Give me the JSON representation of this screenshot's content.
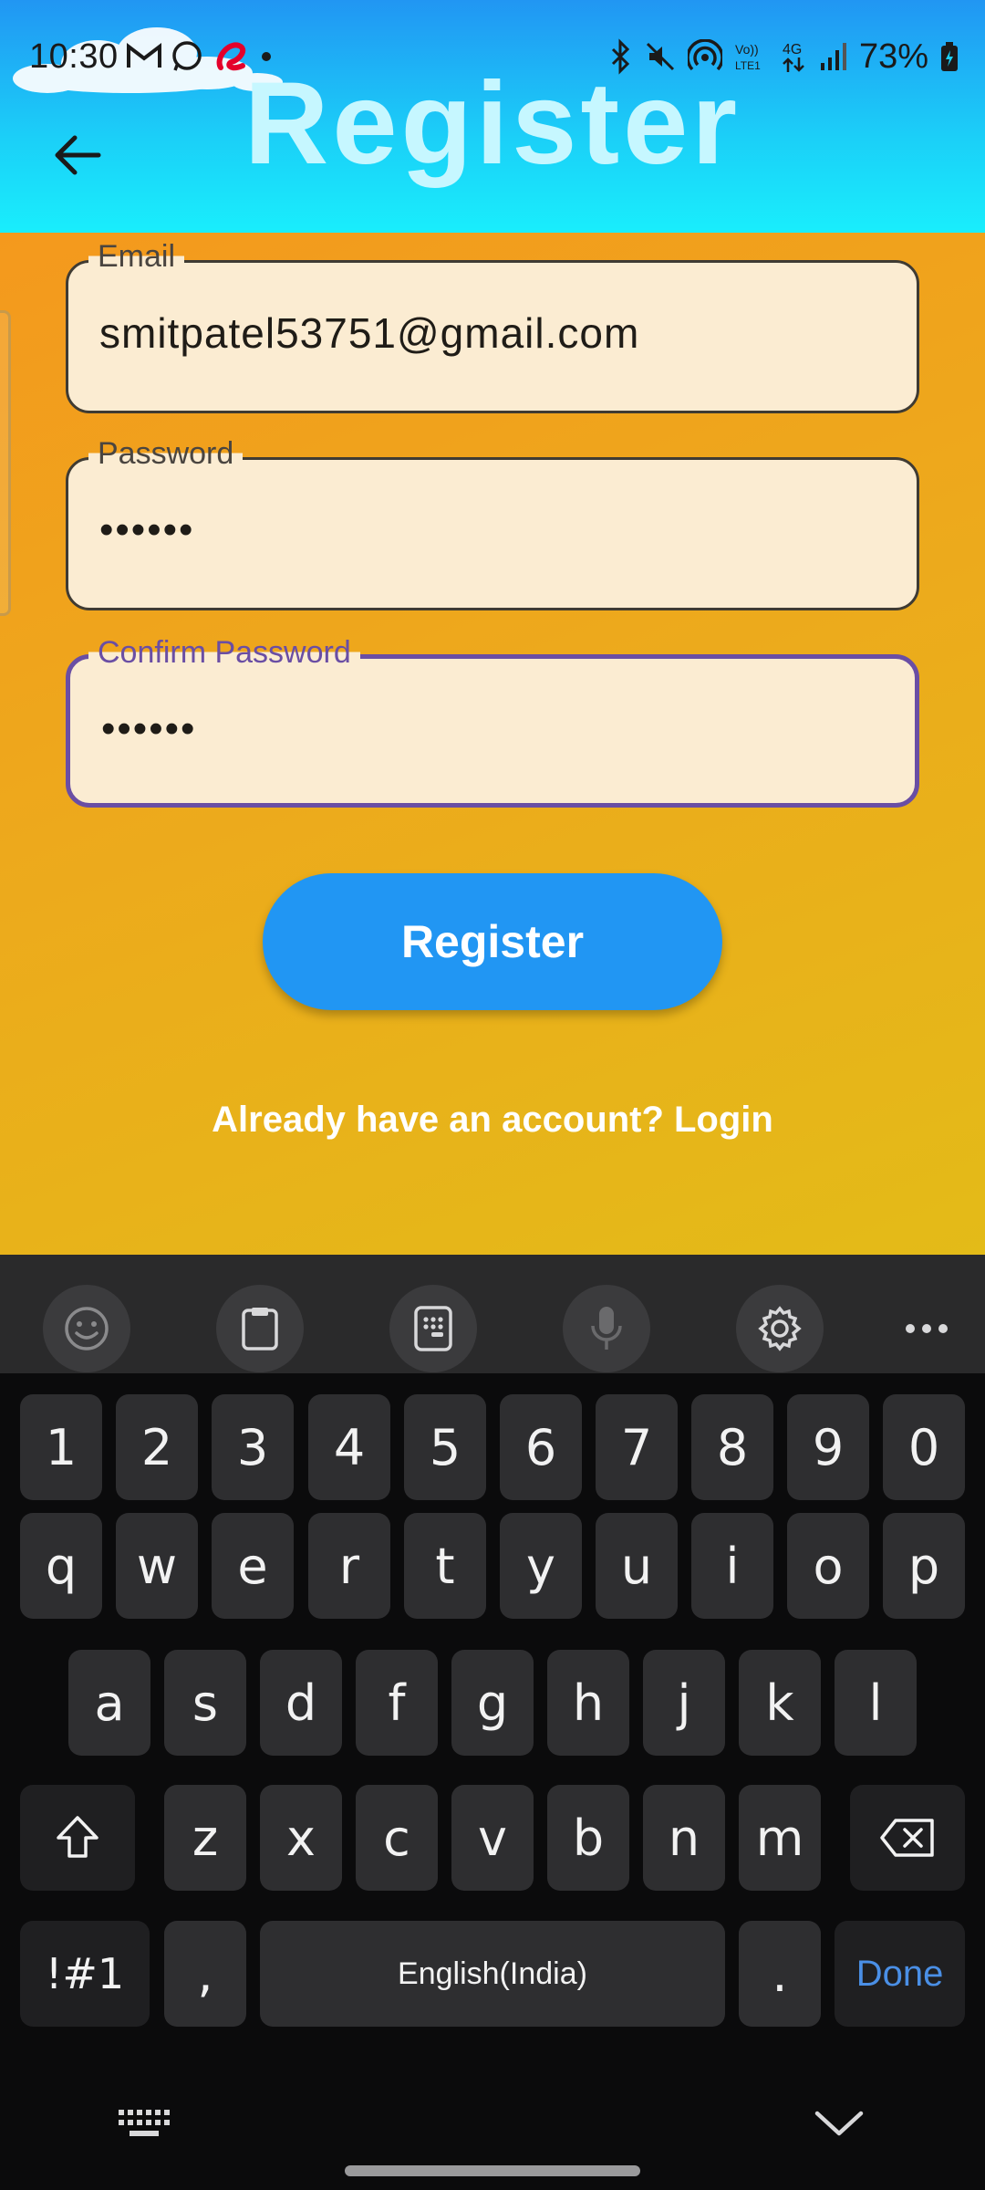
{
  "status_bar": {
    "time": "10:30",
    "battery": "73%",
    "network": "4G"
  },
  "header": {
    "title": "Register",
    "back_icon": "arrow-left-icon",
    "background_top": "#2196f3",
    "background_bottom": "#19eefc"
  },
  "form": {
    "email": {
      "label": "Email",
      "value": "smitpatel53751@gmail.com"
    },
    "password": {
      "label": "Password",
      "value": "••••••"
    },
    "confirm_password": {
      "label": "Confirm Password",
      "value": "••••••"
    },
    "register_button": "Register",
    "login_link": "Already have an account? Login",
    "accent_color": "#6a4ea4",
    "button_color": "#2196f3"
  },
  "keyboard": {
    "toolbar_icons": [
      "emoji-icon",
      "clipboard-icon",
      "keypad-icon",
      "microphone-icon",
      "settings-icon",
      "more-icon"
    ],
    "number_row": [
      "1",
      "2",
      "3",
      "4",
      "5",
      "6",
      "7",
      "8",
      "9",
      "0"
    ],
    "row1": [
      "q",
      "w",
      "e",
      "r",
      "t",
      "y",
      "u",
      "i",
      "o",
      "p"
    ],
    "row2": [
      "a",
      "s",
      "d",
      "f",
      "g",
      "h",
      "j",
      "k",
      "l"
    ],
    "row3": [
      "z",
      "x",
      "c",
      "v",
      "b",
      "n",
      "m"
    ],
    "symbols_key": "!#1",
    "comma_key": ",",
    "space_label": "English(India)",
    "period_key": ".",
    "done_label": "Done",
    "done_color": "#4a8fe6"
  }
}
